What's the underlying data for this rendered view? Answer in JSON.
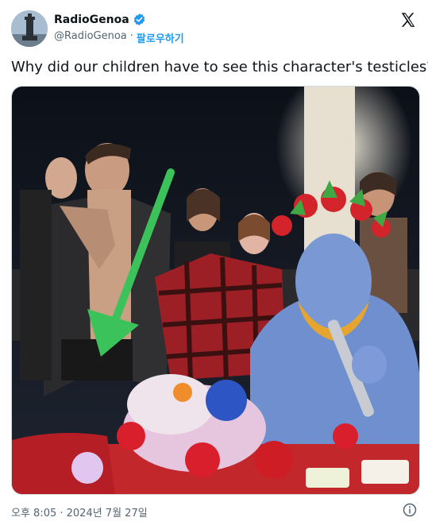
{
  "author": {
    "display_name": "RadioGenoa",
    "handle": "@RadioGenoa",
    "separator": "·",
    "follow_label": "팔로우하기",
    "verified_color": "#1d9bf0",
    "avatar_icon": "lighthouse-avatar"
  },
  "post": {
    "text": "Why did our children have to see this character's testicles?",
    "image_icon": "photo-ceremony-with-green-arrow",
    "arrow_color": "#3cc25a"
  },
  "footer": {
    "timestamp": "오후 8:05 · 2024년 7월 27일",
    "info_icon": "info-icon"
  },
  "brand_icon": "x-logo-icon"
}
